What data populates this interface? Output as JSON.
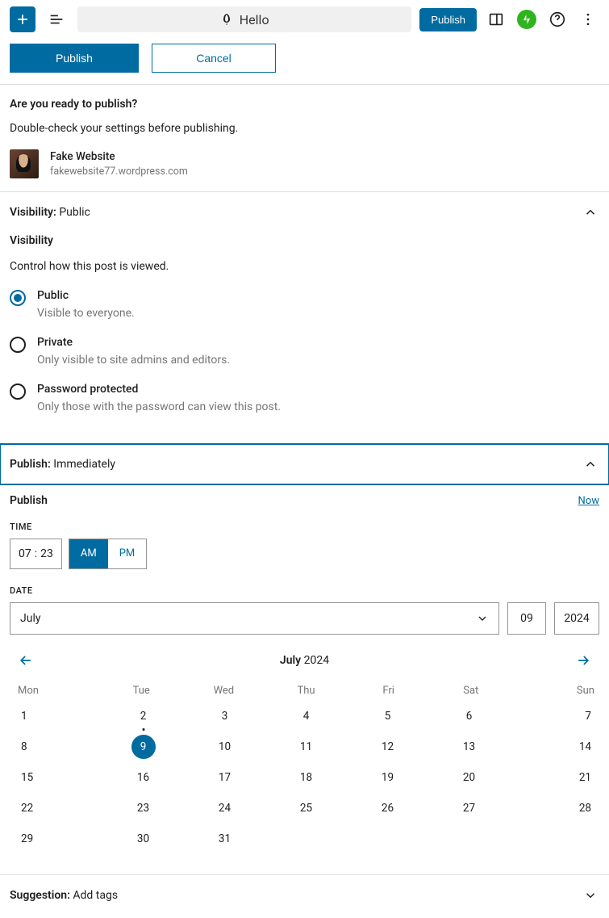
{
  "toolbar": {
    "title": "Hello",
    "publish": "Publish"
  },
  "actions": {
    "publish": "Publish",
    "cancel": "Cancel"
  },
  "ready": {
    "heading": "Are you ready to publish?",
    "sub": "Double-check your settings before publishing.",
    "site_name": "Fake Website",
    "site_url": "fakewebsite77.wordpress.com"
  },
  "visibility": {
    "panel_label": "Visibility:",
    "panel_value": "Public",
    "title": "Visibility",
    "sub": "Control how this post is viewed.",
    "options": [
      {
        "label": "Public",
        "desc": "Visible to everyone.",
        "checked": true
      },
      {
        "label": "Private",
        "desc": "Only visible to site admins and editors.",
        "checked": false
      },
      {
        "label": "Password protected",
        "desc": "Only those with the password can view this post.",
        "checked": false
      }
    ]
  },
  "publish": {
    "panel_label": "Publish:",
    "panel_value": "Immediately",
    "title": "Publish",
    "now": "Now",
    "time_label": "TIME",
    "hour": "07",
    "minute": "23",
    "am": "AM",
    "pm": "PM",
    "date_label": "DATE",
    "month": "July",
    "day": "09",
    "year": "2024"
  },
  "calendar": {
    "month": "July",
    "year": "2024",
    "weekdays": [
      "Mon",
      "Tue",
      "Wed",
      "Thu",
      "Fri",
      "Sat",
      "Sun"
    ],
    "rows": [
      [
        "1",
        "2",
        "3",
        "4",
        "5",
        "6",
        "7"
      ],
      [
        "8",
        "9",
        "10",
        "11",
        "12",
        "13",
        "14"
      ],
      [
        "15",
        "16",
        "17",
        "18",
        "19",
        "20",
        "21"
      ],
      [
        "22",
        "23",
        "24",
        "25",
        "26",
        "27",
        "28"
      ],
      [
        "29",
        "30",
        "31",
        "",
        "",
        "",
        ""
      ]
    ],
    "today": "2",
    "selected": "9"
  },
  "suggestion": {
    "label": "Suggestion:",
    "value": "Add tags"
  }
}
